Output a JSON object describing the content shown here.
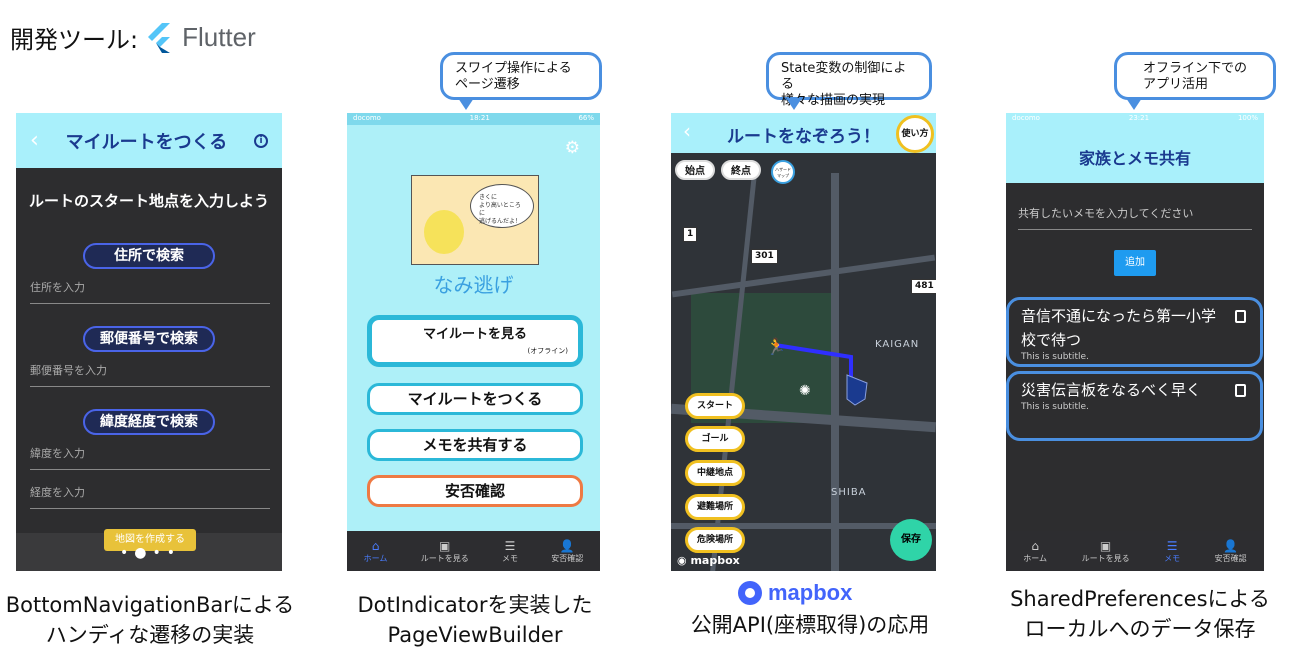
{
  "header": {
    "dev_tools": "開発ツール:",
    "flutter": "Flutter"
  },
  "bubbles": {
    "b2": [
      "スワイプ操作による",
      "ページ遷移"
    ],
    "b3": [
      "State変数の制御による",
      "様々な描画の実現"
    ],
    "b4": [
      "オフライン下での",
      "アプリ活用"
    ]
  },
  "phone1": {
    "title": "マイルートをつくる",
    "heading": "ルートのスタート地点を入力しよう",
    "search_address": "住所で検索",
    "address_placeholder": "住所を入力",
    "search_postal": "郵便番号で検索",
    "postal_placeholder": "郵便番号を入力",
    "search_latlng": "緯度経度で検索",
    "lat_placeholder": "緯度を入力",
    "lng_placeholder": "経度を入力",
    "make_map": "地図を作成する",
    "dots": "•●••"
  },
  "phone2": {
    "status_left": "docomo",
    "status_time": "18:21",
    "status_right": "66%",
    "speech": [
      "きくに",
      "より高いところに",
      "逃げるんだよ！"
    ],
    "app_name": "なみ逃げ",
    "btn_view_route": "マイルートを見る",
    "btn_view_route_sub": "(オフライン)",
    "btn_make_route": "マイルートをつくる",
    "btn_share_memo": "メモを共有する",
    "btn_safety": "安否確認",
    "nav": [
      {
        "icon": "⌂",
        "label": "ホーム"
      },
      {
        "icon": "▣",
        "label": "ルートを見る"
      },
      {
        "icon": "☰",
        "label": "メモ"
      },
      {
        "icon": "👤",
        "label": "安否確認"
      }
    ]
  },
  "phone3": {
    "title": "ルートをなぞろう！",
    "howto": "使い方",
    "start_chip": "始点",
    "end_chip": "終点",
    "hazard": [
      "ハザード",
      "マップ"
    ],
    "sign_1": "1",
    "sign_301": "301",
    "sign_481": "481",
    "label_kaigan": "KAIGAN",
    "label_shiba": "SHIBA",
    "side_buttons": [
      "スタート",
      "ゴール",
      "中継地点",
      "避難場所",
      "危険場所"
    ],
    "save": "保存",
    "mapbox": "mapbox"
  },
  "phone4": {
    "status_left": "docomo",
    "status_time": "23:21",
    "status_right": "100%",
    "title": "家族とメモ共有",
    "input_placeholder": "共有したいメモを入力してください",
    "add": "追加",
    "cards": [
      {
        "title": "音信不通になったら第一小学校で待つ",
        "subtitle": "This is subtitle."
      },
      {
        "title": "災害伝言板をなるべく早く",
        "subtitle": "This is subtitle."
      }
    ],
    "nav": [
      {
        "icon": "⌂",
        "label": "ホーム"
      },
      {
        "icon": "▣",
        "label": "ルートを見る"
      },
      {
        "icon": "☰",
        "label": "メモ"
      },
      {
        "icon": "👤",
        "label": "安否確認"
      }
    ]
  },
  "captions": {
    "c1": [
      "BottomNavigationBarによる",
      "ハンディな遷移の実装"
    ],
    "c2": [
      "DotIndicatorを実装した",
      "PageViewBuilder"
    ],
    "c3_brand": "mapbox",
    "c3": [
      "公開API(座標取得)の応用"
    ],
    "c4": [
      "SharedPreferencesによる",
      "ローカルへのデータ保存"
    ]
  },
  "colors": {
    "app_bar": "#a9f0fb",
    "title_blue": "#1a3a8f",
    "bubble_border": "#4a8fe0",
    "mapbox_blue": "#4264fb",
    "route_blue": "#2f2fff",
    "save_green": "#2fd4a8",
    "yellow": "#f0c020"
  }
}
